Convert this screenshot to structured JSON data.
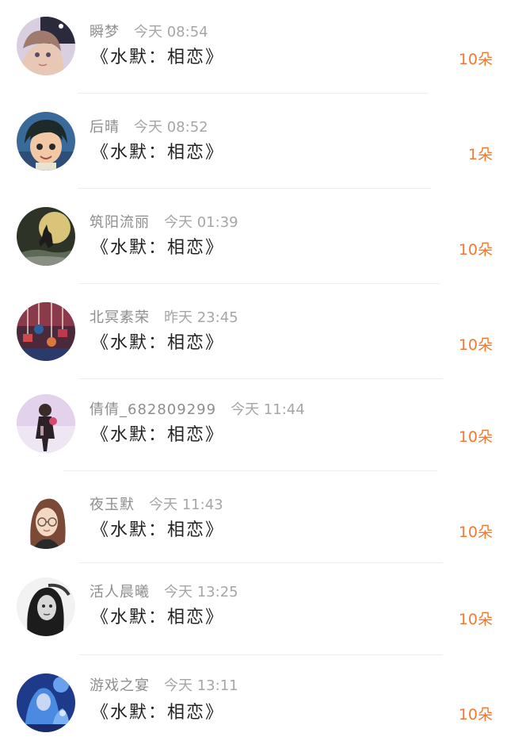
{
  "gift_records": [
    {
      "user": "瞬梦",
      "time": "今天 08:54",
      "gift": "《水默：相恋》",
      "count": "10朵",
      "avatar_icon": "anime-girl-avatar-icon"
    },
    {
      "user": "后晴",
      "time": "今天 08:52",
      "gift": "《水默：相恋》",
      "count": "1朵",
      "avatar_icon": "anime-boy-avatar-icon"
    },
    {
      "user": "筑阳流丽",
      "time": "今天 01:39",
      "gift": "《水默：相恋》",
      "count": "10朵",
      "avatar_icon": "wolf-moon-avatar-icon"
    },
    {
      "user": "北冥素荣",
      "time": "昨天 23:45",
      "gift": "《水默：相恋》",
      "count": "10朵",
      "avatar_icon": "hanging-ornaments-avatar-icon"
    },
    {
      "user": "倩倩_682809299",
      "time": "今天 11:44",
      "gift": "《水默：相恋》",
      "count": "10朵",
      "avatar_icon": "girl-figure-avatar-icon"
    },
    {
      "user": "夜玉默",
      "time": "今天 11:43",
      "gift": "《水默：相恋》",
      "count": "10朵",
      "avatar_icon": "glasses-girl-avatar-icon"
    },
    {
      "user": "活人晨曦",
      "time": "今天 13:25",
      "gift": "《水默：相恋》",
      "count": "10朵",
      "avatar_icon": "bw-portrait-avatar-icon"
    },
    {
      "user": "游戏之宴",
      "time": "今天 13:11",
      "gift": "《水默：相恋》",
      "count": "10朵",
      "avatar_icon": "blue-fantasy-avatar-icon"
    }
  ],
  "colors": {
    "count_accent": "#f07a34",
    "meta_text": "#8e8e8e",
    "title_text": "#222222",
    "divider": "#eeeeee"
  }
}
